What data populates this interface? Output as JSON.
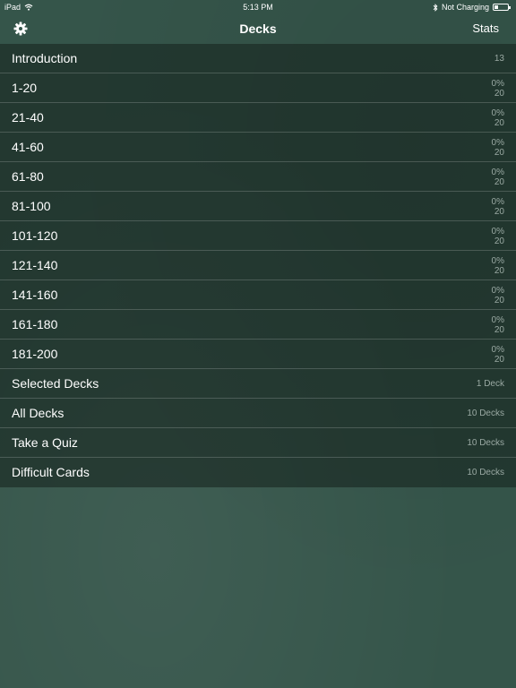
{
  "status_bar": {
    "device": "iPad",
    "time": "5:13 PM",
    "charging": "Not Charging",
    "battery_percent": 30
  },
  "nav": {
    "title": "Decks",
    "right_button": "Stats",
    "left_icon": "gear-icon"
  },
  "decks": [
    {
      "label": "Introduction",
      "detail_top": "",
      "detail_bottom": "13"
    },
    {
      "label": "1-20",
      "detail_top": "0%",
      "detail_bottom": "20"
    },
    {
      "label": "21-40",
      "detail_top": "0%",
      "detail_bottom": "20"
    },
    {
      "label": "41-60",
      "detail_top": "0%",
      "detail_bottom": "20"
    },
    {
      "label": "61-80",
      "detail_top": "0%",
      "detail_bottom": "20"
    },
    {
      "label": "81-100",
      "detail_top": "0%",
      "detail_bottom": "20"
    },
    {
      "label": "101-120",
      "detail_top": "0%",
      "detail_bottom": "20"
    },
    {
      "label": "121-140",
      "detail_top": "0%",
      "detail_bottom": "20"
    },
    {
      "label": "141-160",
      "detail_top": "0%",
      "detail_bottom": "20"
    },
    {
      "label": "161-180",
      "detail_top": "0%",
      "detail_bottom": "20"
    },
    {
      "label": "181-200",
      "detail_top": "0%",
      "detail_bottom": "20"
    },
    {
      "label": "Selected Decks",
      "detail_top": "",
      "detail_bottom": "1 Deck"
    },
    {
      "label": "All Decks",
      "detail_top": "",
      "detail_bottom": "10 Decks"
    },
    {
      "label": "Take a Quiz",
      "detail_top": "",
      "detail_bottom": "10 Decks"
    },
    {
      "label": "Difficult Cards",
      "detail_top": "",
      "detail_bottom": "10 Decks"
    }
  ]
}
